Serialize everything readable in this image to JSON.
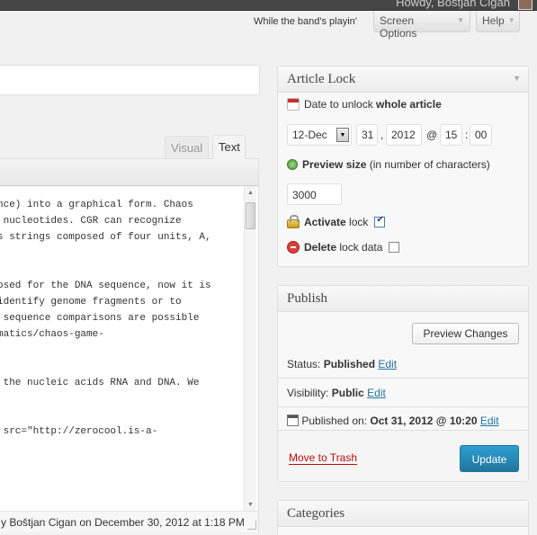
{
  "admin_bar": {
    "howdy": "Howdy, Boštjan Cigan"
  },
  "header": {
    "quote": "While the band's playin'",
    "screen_options_label": "Screen Options",
    "help_label": "Help"
  },
  "editor": {
    "tabs": {
      "visual": "Visual",
      "text": "Text"
    },
    "lines": [
      "nce) into a graphical form. Chaos",
      " nucleotides. CGR can recognize",
      "s strings composed of four units, A,",
      "",
      "",
      "osed for the DNA sequence, now it is",
      "identify genome fragments or to",
      " sequence comparisons are possible",
      "matics/chaos-game-",
      "",
      "",
      " the nucleic acids RNA and DNA. We",
      "",
      "",
      " src=\"http://zerocool.is-a-"
    ],
    "last_edited": "y Boštjan Cigan on December 30, 2012 at 1:18 PM"
  },
  "article_lock": {
    "title": "Article Lock",
    "date_label_prefix": "Date to unlock ",
    "date_label_bold": "whole article",
    "month": "12-Dec",
    "day": "31",
    "year": "2012",
    "hour": "15",
    "minute": "00",
    "preview_label_bold": "Preview size",
    "preview_label_rest": " (in number of characters)",
    "preview_size": "3000",
    "activate_bold": "Activate",
    "activate_rest": " lock",
    "activate_checked": true,
    "delete_bold": "Delete",
    "delete_rest": " lock data",
    "delete_checked": false
  },
  "publish": {
    "title": "Publish",
    "preview_button": "Preview Changes",
    "status_label": "Status: ",
    "status_value": "Published",
    "visibility_label": "Visibility: ",
    "visibility_value": "Public",
    "published_label": "Published on: ",
    "published_value": "Oct 31, 2012 @ 10:20",
    "edit_label": "Edit",
    "trash_label": "Move to Trash",
    "update_label": "Update"
  },
  "categories": {
    "title": "Categories"
  }
}
